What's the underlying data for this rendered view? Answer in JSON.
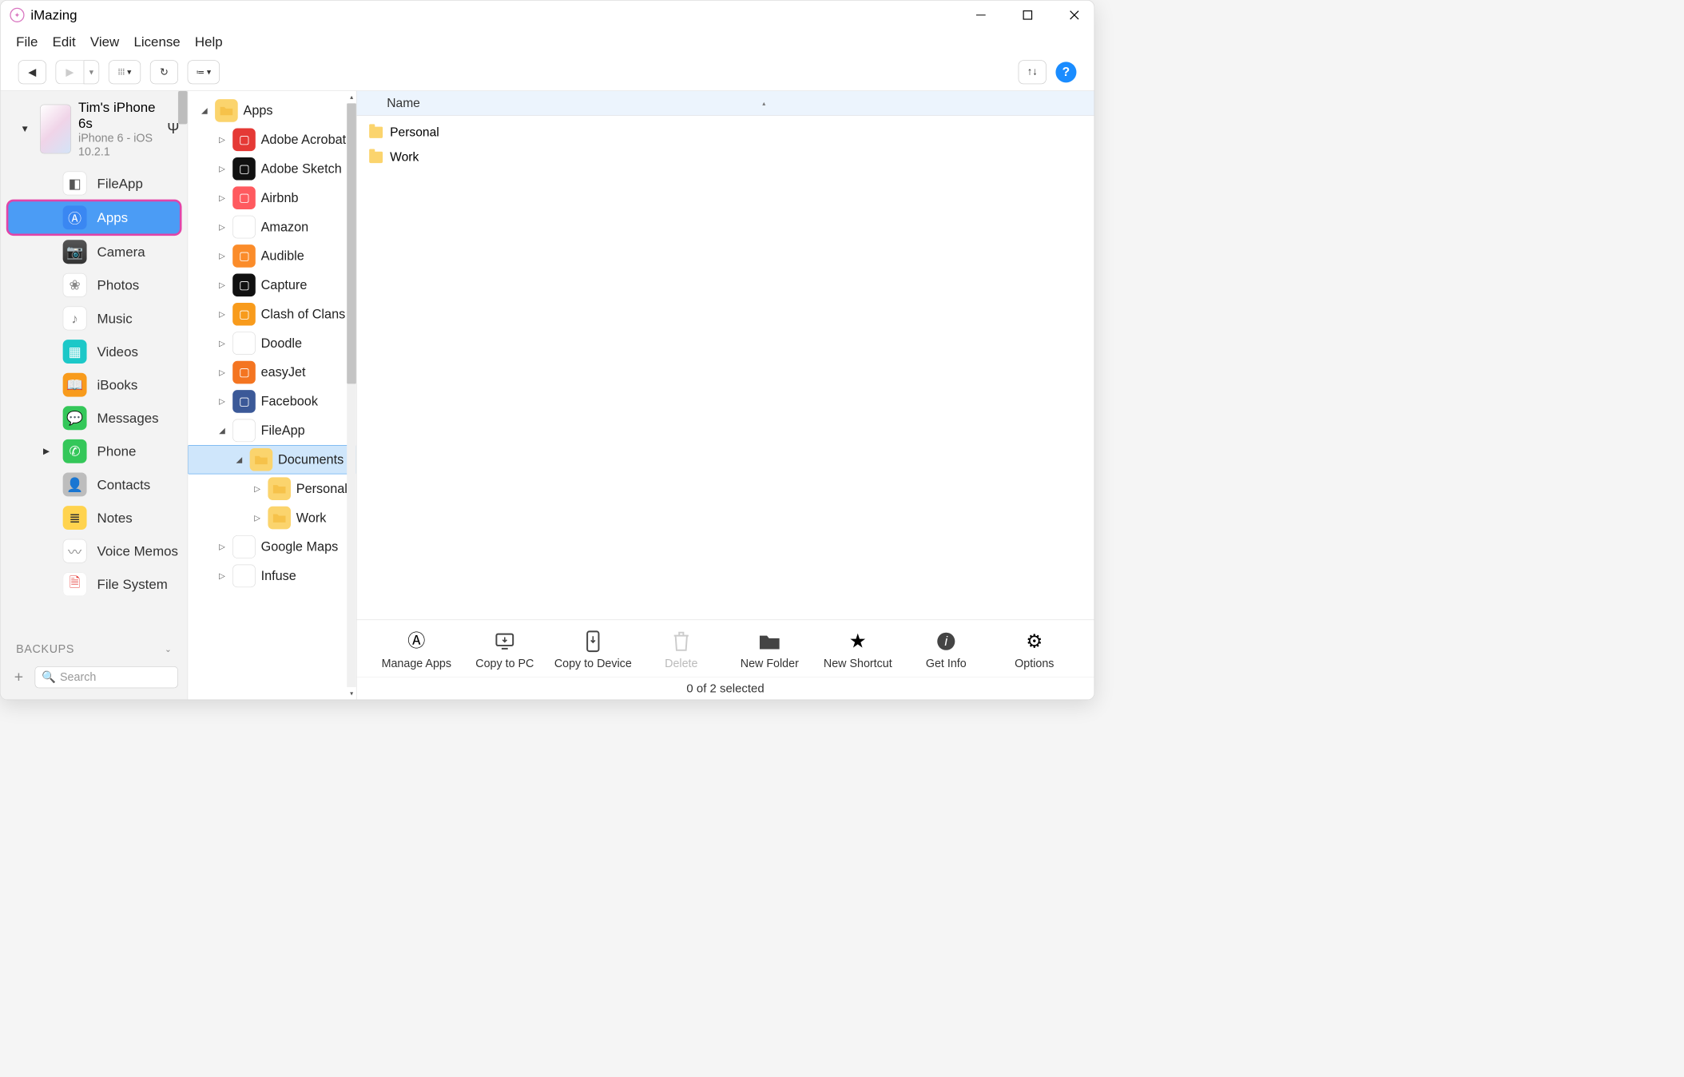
{
  "app": {
    "title": "iMazing"
  },
  "menu": [
    "File",
    "Edit",
    "View",
    "License",
    "Help"
  ],
  "device": {
    "name": "Tim's iPhone 6s",
    "sub": "iPhone 6 - iOS 10.2.1"
  },
  "sidebar_items": [
    {
      "label": "FileApp",
      "icon": "fileapp-icon",
      "cls": "bg-flat"
    },
    {
      "label": "Apps",
      "icon": "apps-icon",
      "cls": "bg-blue",
      "selected": true
    },
    {
      "label": "Camera",
      "icon": "camera-icon",
      "cls": "bg-cam"
    },
    {
      "label": "Photos",
      "icon": "photos-icon",
      "cls": "bg-white"
    },
    {
      "label": "Music",
      "icon": "music-icon",
      "cls": "bg-white"
    },
    {
      "label": "Videos",
      "icon": "videos-icon",
      "cls": "bg-teal"
    },
    {
      "label": "iBooks",
      "icon": "ibooks-icon",
      "cls": "bg-orange"
    },
    {
      "label": "Messages",
      "icon": "messages-icon",
      "cls": "bg-green"
    },
    {
      "label": "Phone",
      "icon": "phone-icon",
      "cls": "bg-green",
      "expandable": true
    },
    {
      "label": "Contacts",
      "icon": "contacts-icon",
      "cls": "bg-grey"
    },
    {
      "label": "Notes",
      "icon": "notes-icon",
      "cls": "bg-yel"
    },
    {
      "label": "Voice Memos",
      "icon": "voicememos-icon",
      "cls": "bg-white"
    },
    {
      "label": "File System",
      "icon": "filesystem-icon",
      "cls": "bg-lred"
    }
  ],
  "backups_header": "BACKUPS",
  "search_placeholder": "Search",
  "tree": {
    "root": "Apps",
    "apps": [
      {
        "label": "Adobe Acrobat",
        "cls": "bg-red"
      },
      {
        "label": "Adobe Sketch",
        "cls": "bg-black"
      },
      {
        "label": "Airbnb",
        "cls": "bg-pink"
      },
      {
        "label": "Amazon",
        "cls": "bg-white"
      },
      {
        "label": "Audible",
        "cls": "bg-darkor"
      },
      {
        "label": "Capture",
        "cls": "bg-black"
      },
      {
        "label": "Clash of Clans",
        "cls": "bg-orange"
      },
      {
        "label": "Doodle",
        "cls": "bg-white"
      },
      {
        "label": "easyJet",
        "cls": "bg-oran2"
      },
      {
        "label": "Facebook",
        "cls": "bg-fb"
      },
      {
        "label": "FileApp",
        "cls": "bg-flat",
        "expanded": true,
        "children": [
          {
            "label": "Documents",
            "selected": true,
            "children": [
              {
                "label": "Personal"
              },
              {
                "label": "Work"
              }
            ]
          }
        ]
      },
      {
        "label": "Google Maps",
        "cls": "bg-white"
      },
      {
        "label": "Infuse",
        "cls": "bg-white"
      }
    ]
  },
  "list": {
    "header": "Name",
    "rows": [
      "Personal",
      "Work"
    ]
  },
  "actions": [
    {
      "label": "Manage Apps",
      "icon": "manage-apps-icon"
    },
    {
      "label": "Copy to PC",
      "icon": "copy-to-pc-icon"
    },
    {
      "label": "Copy to Device",
      "icon": "copy-to-device-icon"
    },
    {
      "label": "Delete",
      "icon": "delete-icon",
      "disabled": true
    },
    {
      "label": "New Folder",
      "icon": "new-folder-icon"
    },
    {
      "label": "New Shortcut",
      "icon": "new-shortcut-icon"
    },
    {
      "label": "Get Info",
      "icon": "get-info-icon"
    },
    {
      "label": "Options",
      "icon": "options-icon"
    }
  ],
  "status": "0 of 2 selected"
}
